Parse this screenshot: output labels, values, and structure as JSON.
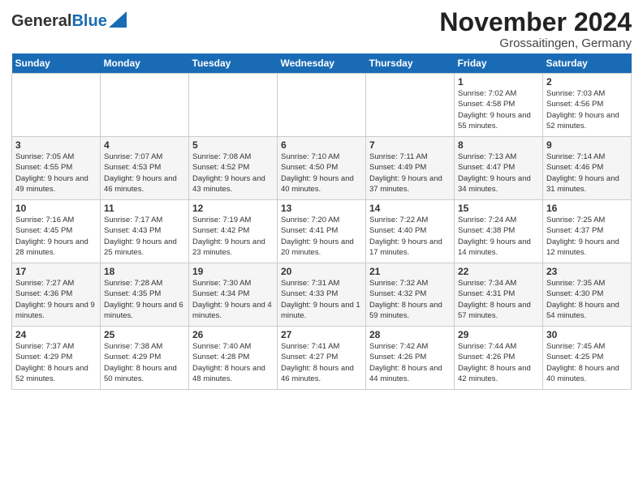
{
  "header": {
    "logo_general": "General",
    "logo_blue": "Blue",
    "month_title": "November 2024",
    "location": "Grossaitingen, Germany"
  },
  "days_of_week": [
    "Sunday",
    "Monday",
    "Tuesday",
    "Wednesday",
    "Thursday",
    "Friday",
    "Saturday"
  ],
  "weeks": [
    [
      {
        "day": "",
        "info": ""
      },
      {
        "day": "",
        "info": ""
      },
      {
        "day": "",
        "info": ""
      },
      {
        "day": "",
        "info": ""
      },
      {
        "day": "",
        "info": ""
      },
      {
        "day": "1",
        "info": "Sunrise: 7:02 AM\nSunset: 4:58 PM\nDaylight: 9 hours and 55 minutes."
      },
      {
        "day": "2",
        "info": "Sunrise: 7:03 AM\nSunset: 4:56 PM\nDaylight: 9 hours and 52 minutes."
      }
    ],
    [
      {
        "day": "3",
        "info": "Sunrise: 7:05 AM\nSunset: 4:55 PM\nDaylight: 9 hours and 49 minutes."
      },
      {
        "day": "4",
        "info": "Sunrise: 7:07 AM\nSunset: 4:53 PM\nDaylight: 9 hours and 46 minutes."
      },
      {
        "day": "5",
        "info": "Sunrise: 7:08 AM\nSunset: 4:52 PM\nDaylight: 9 hours and 43 minutes."
      },
      {
        "day": "6",
        "info": "Sunrise: 7:10 AM\nSunset: 4:50 PM\nDaylight: 9 hours and 40 minutes."
      },
      {
        "day": "7",
        "info": "Sunrise: 7:11 AM\nSunset: 4:49 PM\nDaylight: 9 hours and 37 minutes."
      },
      {
        "day": "8",
        "info": "Sunrise: 7:13 AM\nSunset: 4:47 PM\nDaylight: 9 hours and 34 minutes."
      },
      {
        "day": "9",
        "info": "Sunrise: 7:14 AM\nSunset: 4:46 PM\nDaylight: 9 hours and 31 minutes."
      }
    ],
    [
      {
        "day": "10",
        "info": "Sunrise: 7:16 AM\nSunset: 4:45 PM\nDaylight: 9 hours and 28 minutes."
      },
      {
        "day": "11",
        "info": "Sunrise: 7:17 AM\nSunset: 4:43 PM\nDaylight: 9 hours and 25 minutes."
      },
      {
        "day": "12",
        "info": "Sunrise: 7:19 AM\nSunset: 4:42 PM\nDaylight: 9 hours and 23 minutes."
      },
      {
        "day": "13",
        "info": "Sunrise: 7:20 AM\nSunset: 4:41 PM\nDaylight: 9 hours and 20 minutes."
      },
      {
        "day": "14",
        "info": "Sunrise: 7:22 AM\nSunset: 4:40 PM\nDaylight: 9 hours and 17 minutes."
      },
      {
        "day": "15",
        "info": "Sunrise: 7:24 AM\nSunset: 4:38 PM\nDaylight: 9 hours and 14 minutes."
      },
      {
        "day": "16",
        "info": "Sunrise: 7:25 AM\nSunset: 4:37 PM\nDaylight: 9 hours and 12 minutes."
      }
    ],
    [
      {
        "day": "17",
        "info": "Sunrise: 7:27 AM\nSunset: 4:36 PM\nDaylight: 9 hours and 9 minutes."
      },
      {
        "day": "18",
        "info": "Sunrise: 7:28 AM\nSunset: 4:35 PM\nDaylight: 9 hours and 6 minutes."
      },
      {
        "day": "19",
        "info": "Sunrise: 7:30 AM\nSunset: 4:34 PM\nDaylight: 9 hours and 4 minutes."
      },
      {
        "day": "20",
        "info": "Sunrise: 7:31 AM\nSunset: 4:33 PM\nDaylight: 9 hours and 1 minute."
      },
      {
        "day": "21",
        "info": "Sunrise: 7:32 AM\nSunset: 4:32 PM\nDaylight: 8 hours and 59 minutes."
      },
      {
        "day": "22",
        "info": "Sunrise: 7:34 AM\nSunset: 4:31 PM\nDaylight: 8 hours and 57 minutes."
      },
      {
        "day": "23",
        "info": "Sunrise: 7:35 AM\nSunset: 4:30 PM\nDaylight: 8 hours and 54 minutes."
      }
    ],
    [
      {
        "day": "24",
        "info": "Sunrise: 7:37 AM\nSunset: 4:29 PM\nDaylight: 8 hours and 52 minutes."
      },
      {
        "day": "25",
        "info": "Sunrise: 7:38 AM\nSunset: 4:29 PM\nDaylight: 8 hours and 50 minutes."
      },
      {
        "day": "26",
        "info": "Sunrise: 7:40 AM\nSunset: 4:28 PM\nDaylight: 8 hours and 48 minutes."
      },
      {
        "day": "27",
        "info": "Sunrise: 7:41 AM\nSunset: 4:27 PM\nDaylight: 8 hours and 46 minutes."
      },
      {
        "day": "28",
        "info": "Sunrise: 7:42 AM\nSunset: 4:26 PM\nDaylight: 8 hours and 44 minutes."
      },
      {
        "day": "29",
        "info": "Sunrise: 7:44 AM\nSunset: 4:26 PM\nDaylight: 8 hours and 42 minutes."
      },
      {
        "day": "30",
        "info": "Sunrise: 7:45 AM\nSunset: 4:25 PM\nDaylight: 8 hours and 40 minutes."
      }
    ]
  ]
}
